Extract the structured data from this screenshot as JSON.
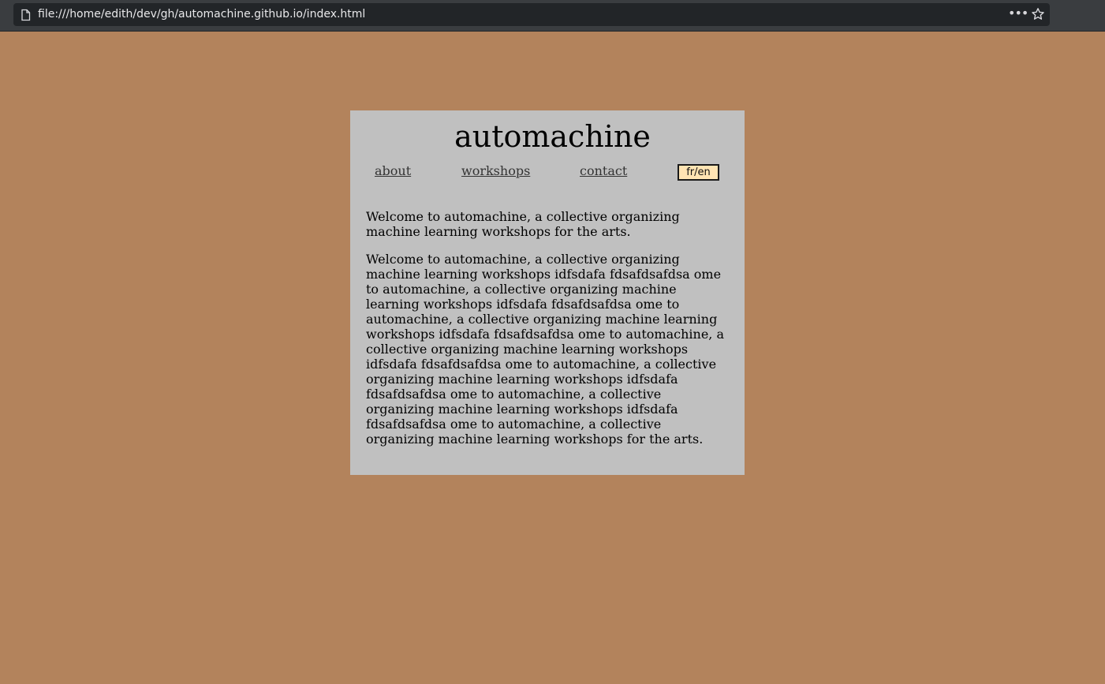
{
  "browser": {
    "url": "file:///home/edith/dev/gh/automachine.github.io/index.html",
    "icons": [
      "page-icon",
      "more-icon",
      "bookmark-star-icon"
    ]
  },
  "site": {
    "title": "automachine",
    "nav": {
      "about": "about",
      "workshops": "workshops",
      "contact": "contact"
    },
    "lang_toggle": "fr/en",
    "paragraphs": [
      "Welcome to automachine, a collective organizing machine learning workshops for the arts.",
      "Welcome to automachine, a collective organizing machine learning workshops idfsdafa fdsafdsafdsa ome to automachine, a collective organizing machine learning workshops idfsdafa fdsafdsafdsa ome to automachine, a collective organizing machine learning workshops idfsdafa fdsafdsafdsa ome to automachine, a collective organizing machine learning workshops idfsdafa fdsafdsafdsa ome to automachine, a collective organizing machine learning workshops idfsdafa fdsafdsafdsa ome to automachine, a collective organizing machine learning workshops idfsdafa fdsafdsafdsa ome to automachine, a collective organizing machine learning workshops for the arts."
    ]
  },
  "colors": {
    "page_background": "#b3835c",
    "card_background": "#c0c0c0",
    "toggle_background": "#ffe4b3"
  }
}
